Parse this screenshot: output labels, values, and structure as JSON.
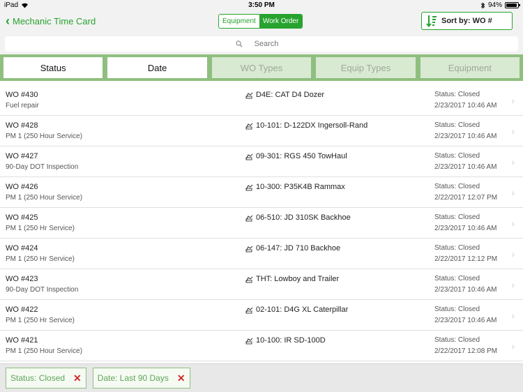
{
  "status_bar": {
    "device": "iPad",
    "time": "3:50 PM",
    "battery": "94%",
    "battery_level": 0.94
  },
  "nav": {
    "back_label": "Mechanic Time Card",
    "segments": [
      {
        "label": "Equipment"
      },
      {
        "label": "Work Order"
      }
    ],
    "sort_label": "Sort by: WO #"
  },
  "search": {
    "placeholder": "Search"
  },
  "filter_tabs": [
    {
      "label": "Status"
    },
    {
      "label": "Date"
    },
    {
      "label": "WO Types"
    },
    {
      "label": "Equip Types"
    },
    {
      "label": "Equipment"
    }
  ],
  "rows": [
    {
      "wo": "WO #430",
      "desc": "Fuel repair",
      "equip": "D4E:  CAT D4 Dozer",
      "status": "Status:   Closed",
      "date": "2/23/2017 10:46 AM"
    },
    {
      "wo": "WO #428",
      "desc": "PM 1 (250 Hour Service)",
      "equip": "10-101:  D-122DX Ingersoll-Rand",
      "status": "Status:   Closed",
      "date": "2/23/2017 10:46 AM"
    },
    {
      "wo": "WO #427",
      "desc": "90-Day DOT Inspection",
      "equip": "09-301:  RGS 450 TowHaul",
      "status": "Status:   Closed",
      "date": "2/23/2017 10:46 AM"
    },
    {
      "wo": "WO #426",
      "desc": "PM 1 (250 Hour Service)",
      "equip": "10-300:  P35K4B Rammax",
      "status": "Status:   Closed",
      "date": "2/22/2017 12:07 PM"
    },
    {
      "wo": "WO #425",
      "desc": "PM 1 (250 Hr Service)",
      "equip": "06-510:  JD 310SK Backhoe",
      "status": "Status:   Closed",
      "date": "2/23/2017 10:46 AM"
    },
    {
      "wo": "WO #424",
      "desc": "PM 1 (250 Hr Service)",
      "equip": "06-147:  JD 710 Backhoe",
      "status": "Status:   Closed",
      "date": "2/22/2017 12:12 PM"
    },
    {
      "wo": "WO #423",
      "desc": "90-Day DOT Inspection",
      "equip": "THT:  Lowboy and Trailer",
      "status": "Status:   Closed",
      "date": "2/23/2017 10:46 AM"
    },
    {
      "wo": "WO #422",
      "desc": "PM 1 (250 Hr Service)",
      "equip": "02-101:  D4G XL Caterpillar",
      "status": "Status:   Closed",
      "date": "2/23/2017 10:46 AM"
    },
    {
      "wo": "WO #421",
      "desc": "PM 1 (250 Hour Service)",
      "equip": "10-100:  IR SD-100D",
      "status": "Status:   Closed",
      "date": "2/22/2017 12:08 PM"
    }
  ],
  "chips": [
    {
      "label": "Status: Closed"
    },
    {
      "label": "Date: Last 90 Days"
    }
  ],
  "colors": {
    "accent": "#27a32e",
    "filter_bar": "#8fbf7f",
    "remove": "#d12b2b"
  }
}
